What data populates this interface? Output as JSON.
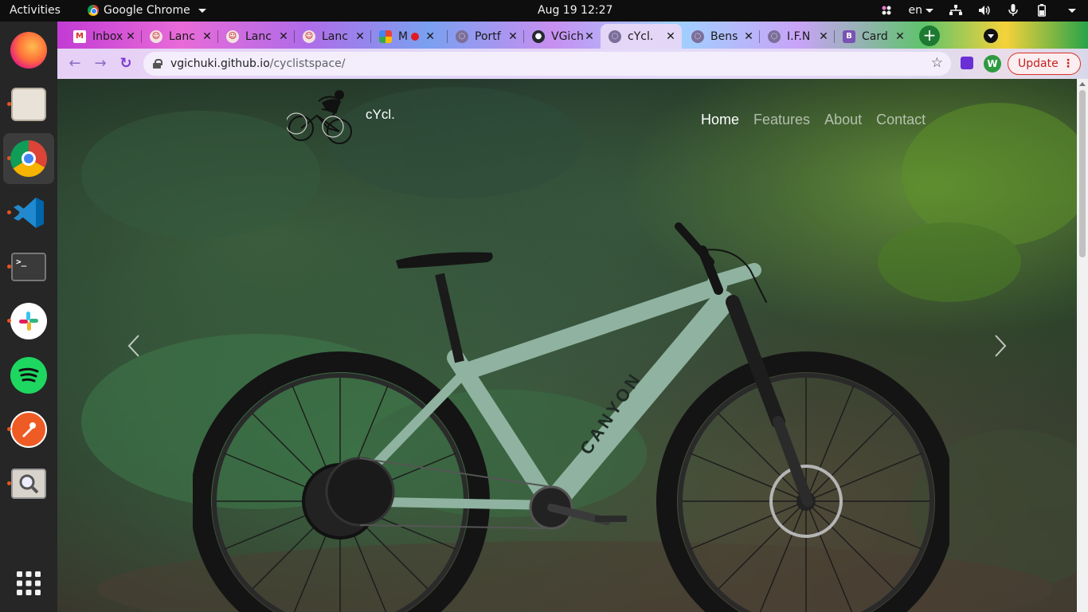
{
  "system": {
    "activities": "Activities",
    "app_name": "Google Chrome",
    "clock": "Aug 19  12:27",
    "keyboard": "en"
  },
  "dock": {
    "apps": [
      "firefox",
      "files",
      "chrome",
      "vscode",
      "terminal",
      "slack",
      "spotify",
      "postman",
      "image-viewer",
      "show-apps"
    ]
  },
  "tabs": [
    {
      "title": "Inbox",
      "favicon": "gmail"
    },
    {
      "title": "Lanc",
      "favicon": "lance"
    },
    {
      "title": "Lanc",
      "favicon": "lance"
    },
    {
      "title": "Lanc",
      "favicon": "lance"
    },
    {
      "title": "M",
      "favicon": "multicolor"
    },
    {
      "title": "Portf",
      "favicon": "globe"
    },
    {
      "title": "VGich",
      "favicon": "github"
    },
    {
      "title": "cYcl.",
      "favicon": "globe",
      "active": true
    },
    {
      "title": "Bens",
      "favicon": "globe"
    },
    {
      "title": "I.F.N",
      "favicon": "globe"
    },
    {
      "title": "Card",
      "favicon": "bootstrap"
    }
  ],
  "toolbar": {
    "url_host": "vgichuki.github.io",
    "url_path": "/cyclistspace/",
    "profile_initial": "W",
    "update_label": "Update"
  },
  "site": {
    "brand": "cYcl.",
    "nav": [
      "Home",
      "Features",
      "About",
      "Contact"
    ],
    "active_nav": "Home"
  },
  "bike_brand": "CANYON",
  "colors": {
    "frame": "#8fb3a0",
    "tab_active": "#e3d6f6",
    "update_red": "#d93025"
  }
}
